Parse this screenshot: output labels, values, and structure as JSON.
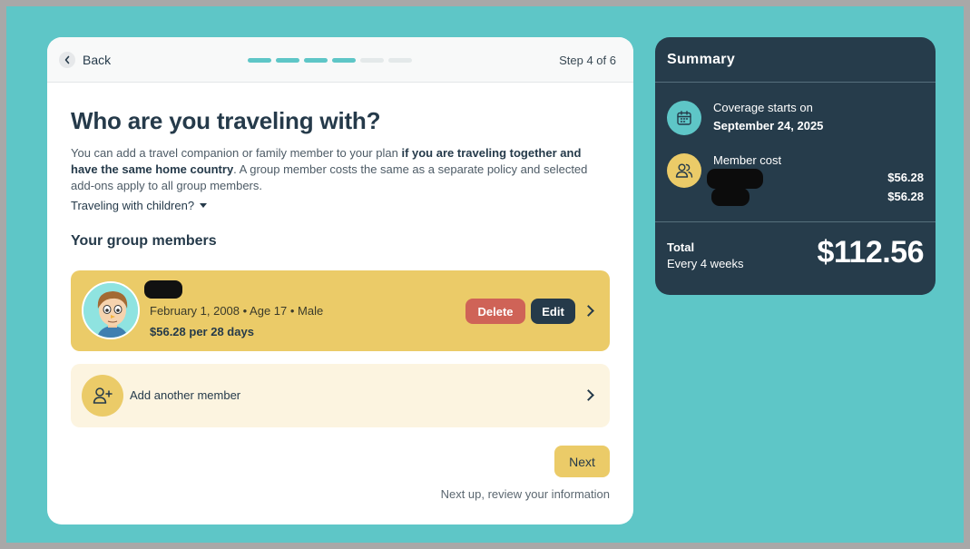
{
  "header": {
    "back_label": "Back",
    "step_text": "Step 4 of 6",
    "progress": {
      "total_steps": 6,
      "completed_steps": 4
    }
  },
  "page": {
    "title": "Who are you traveling with?",
    "description_part1": "You can add a travel companion or family member to your plan ",
    "description_bold": "if you are traveling together and have the same home country",
    "description_part2": ". A group member costs the same as a separate policy and selected add-ons apply to all group members.",
    "children_toggle": "Traveling with children?",
    "group_heading": "Your group members"
  },
  "member": {
    "details": "February 1, 2008 • Age 17 • Male",
    "price": "$56.28 per 28 days",
    "delete_label": "Delete",
    "edit_label": "Edit"
  },
  "add_member": {
    "label": "Add another member"
  },
  "footer": {
    "next_label": "Next",
    "next_hint": "Next up, review your information"
  },
  "summary": {
    "title": "Summary",
    "coverage_label": "Coverage starts on",
    "coverage_date": "September 24, 2025",
    "member_cost_label": "Member cost",
    "member_costs": [
      "$56.28",
      "$56.28"
    ],
    "total_label": "Total",
    "total_period": "Every 4 weeks",
    "total_amount": "$112.56"
  },
  "colors": {
    "background": "#5ec6c7",
    "accent_teal": "#5ec6c7",
    "accent_yellow": "#ebcb68",
    "dark": "#253a4a",
    "delete": "#cf6357"
  }
}
